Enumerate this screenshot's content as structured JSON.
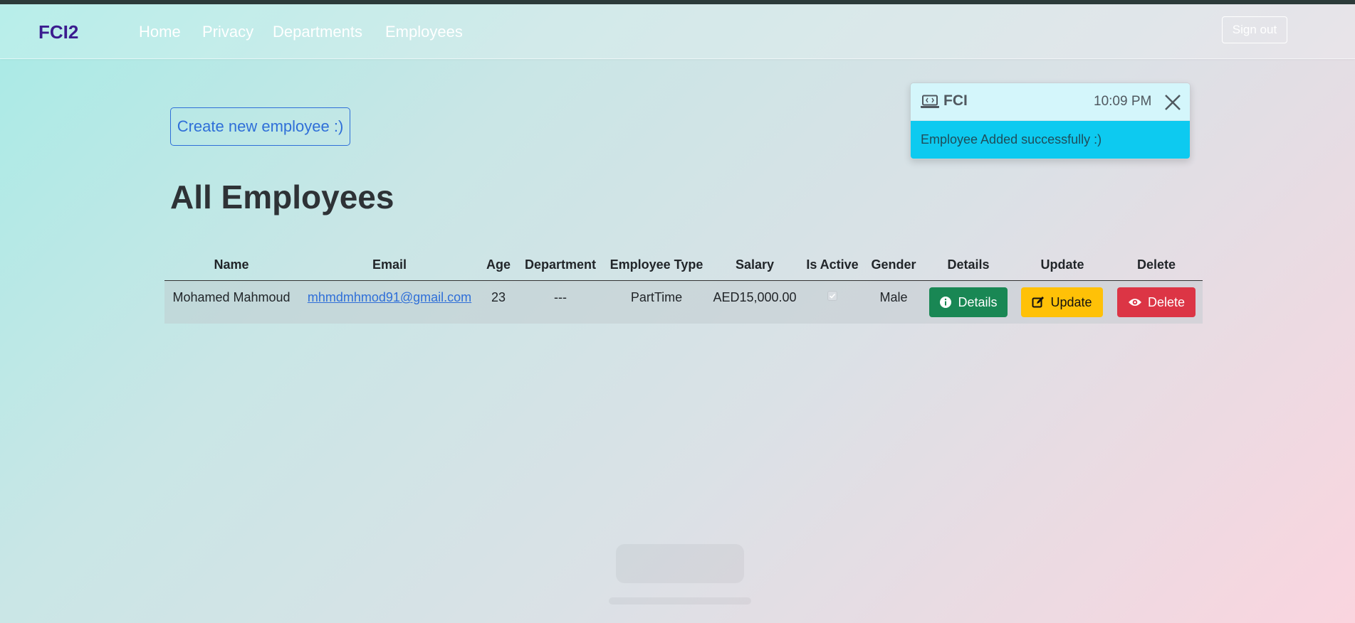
{
  "navbar": {
    "brand": "FCI2",
    "links": [
      "Home",
      "Privacy",
      "Departments",
      "Employees"
    ],
    "signout_label": "Sign out"
  },
  "page": {
    "create_button": "Create new employee :)",
    "title": "All Employees"
  },
  "table": {
    "headers": [
      "Name",
      "Email",
      "Age",
      "Department",
      "Employee Type",
      "Salary",
      "Is Active",
      "Gender",
      "Details",
      "Update",
      "Delete"
    ],
    "rows": [
      {
        "name": "Mohamed Mahmoud",
        "email": "mhmdmhmod91@gmail.com",
        "age": "23",
        "department": "---",
        "employee_type": "PartTime",
        "salary": "AED15,000.00",
        "is_active": true,
        "gender": "Male",
        "details_label": "Details",
        "update_label": "Update",
        "delete_label": "Delete"
      }
    ]
  },
  "toast": {
    "title": "FCI",
    "time": "10:09 PM",
    "message": "Employee Added successfully :)"
  },
  "icons": {
    "toast_icon": "laptop-code-icon",
    "close": "close-icon",
    "details": "info-circle-icon",
    "update": "edit-icon",
    "delete": "eye-icon"
  },
  "colors": {
    "brand": "#3b1b8f",
    "details_btn": "#198754",
    "update_btn": "#ffc107",
    "delete_btn": "#dc3545",
    "toast_body": "#0dcaf0",
    "link": "#2f6fd8"
  }
}
